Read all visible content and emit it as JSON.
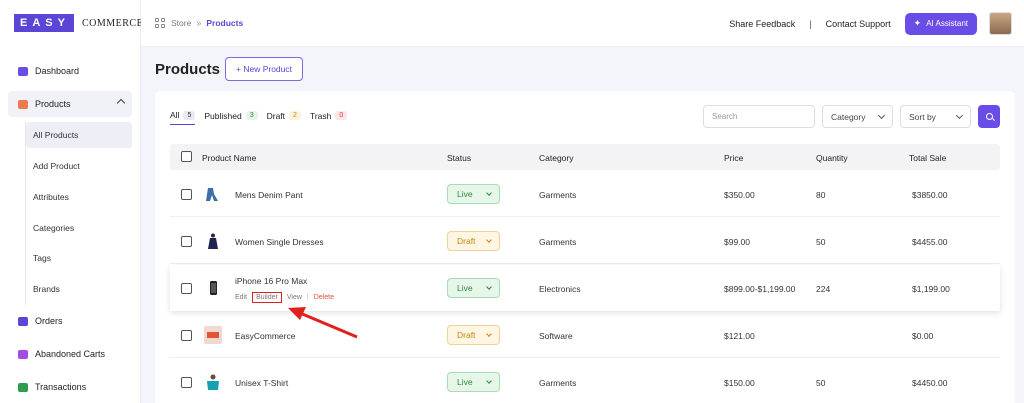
{
  "brand": {
    "box": "EASY",
    "text": "COMMERCE"
  },
  "sidebar": {
    "items": [
      {
        "label": "Dashboard",
        "icon": "dashboard-icon",
        "color": "#6a4ce6"
      },
      {
        "label": "Products",
        "icon": "box-icon",
        "color": "#f07a4f"
      },
      {
        "label": "Orders",
        "icon": "orders-icon",
        "color": "#5b45d6"
      },
      {
        "label": "Abandoned Carts",
        "icon": "cart-icon",
        "color": "#a64ce6"
      },
      {
        "label": "Transactions",
        "icon": "money-icon",
        "color": "#2e9e4e"
      }
    ],
    "sub_items": [
      "All Products",
      "Add Product",
      "Attributes",
      "Categories",
      "Tags",
      "Brands"
    ]
  },
  "breadcrumb": {
    "root": "Store",
    "sep": "»",
    "current": "Products"
  },
  "header": {
    "share_feedback": "Share Feedback",
    "separator": "|",
    "contact_support": "Contact Support",
    "ai_assistant": "AI Assistant"
  },
  "page": {
    "title": "Products",
    "new_button": "+ New Product"
  },
  "tabs": [
    {
      "label": "All",
      "count": "5"
    },
    {
      "label": "Published",
      "count": "3"
    },
    {
      "label": "Draft",
      "count": "2"
    },
    {
      "label": "Trash",
      "count": "0"
    }
  ],
  "filters": {
    "search_placeholder": "Search",
    "category": "Category",
    "sort_by": "Sort by"
  },
  "table": {
    "headers": [
      "Product Name",
      "Status",
      "Category",
      "Price",
      "Quantity",
      "Total Sale"
    ],
    "rows": [
      {
        "name": "Mens Denim Pant",
        "status": "Live",
        "category": "Garments",
        "price": "$350.00",
        "quantity": "80",
        "total": "$3850.00"
      },
      {
        "name": "Women Single Dresses",
        "status": "Draft",
        "category": "Garments",
        "price": "$99.00",
        "quantity": "50",
        "total": "$4455.00"
      },
      {
        "name": "iPhone 16 Pro Max",
        "status": "Live",
        "category": "Electronics",
        "price": "$899.00-$1,199.00",
        "quantity": "224",
        "total": "$1,199.00"
      },
      {
        "name": "EasyCommerce",
        "status": "Draft",
        "category": "Software",
        "price": "$121.00",
        "quantity": "",
        "total": "$0.00"
      },
      {
        "name": "Unisex T-Shirt",
        "status": "Live",
        "category": "Garments",
        "price": "$150.00",
        "quantity": "50",
        "total": "$4450.00"
      }
    ],
    "row_actions": {
      "edit": "Edit",
      "builder": "Builder",
      "view": "View",
      "delete": "Delete",
      "sep": "|"
    }
  },
  "colors": {
    "accent": "#6a4ce6",
    "live": "#2e8b3e",
    "draft": "#c48a16",
    "annotation": "#e01f1f"
  }
}
